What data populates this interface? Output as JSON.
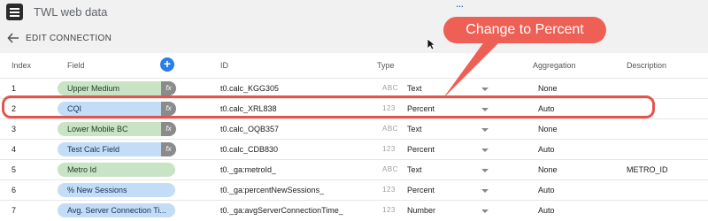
{
  "app": {
    "title": "TWL web data",
    "top_mark": "…"
  },
  "header": {
    "title": "EDIT CONNECTION"
  },
  "table": {
    "columns": {
      "index": "Index",
      "field": "Field",
      "id": "ID",
      "type": "Type",
      "aggregation": "Aggregation",
      "description": "Description"
    },
    "add_button": "+",
    "rows": [
      {
        "index": "1",
        "field": "Upper Medium",
        "chip": "green",
        "fx": "fx",
        "id": "t0.calc_KGG305",
        "type_icon": "ABC",
        "type": "Text",
        "aggregation": "None",
        "description": ""
      },
      {
        "index": "2",
        "field": "CQI",
        "chip": "blue",
        "fx": "fx",
        "id": "t0.calc_XRL838",
        "type_icon": "123",
        "type": "Percent",
        "aggregation": "Auto",
        "description": ""
      },
      {
        "index": "3",
        "field": "Lower Mobile BC",
        "chip": "green",
        "fx": "fx",
        "id": "t0.calc_OQB357",
        "type_icon": "ABC",
        "type": "Text",
        "aggregation": "None",
        "description": ""
      },
      {
        "index": "4",
        "field": "Test Calc Field",
        "chip": "blue",
        "fx": "fx",
        "id": "t0.calc_CDB830",
        "type_icon": "123",
        "type": "Percent",
        "aggregation": "Auto",
        "description": ""
      },
      {
        "index": "5",
        "field": "Metro Id",
        "chip": "green",
        "fx": "",
        "id": "t0._ga:metroId_",
        "type_icon": "ABC",
        "type": "Text",
        "aggregation": "None",
        "description": "METRO_ID"
      },
      {
        "index": "6",
        "field": "% New Sessions",
        "chip": "blue",
        "fx": "",
        "id": "t0._ga:percentNewSessions_",
        "type_icon": "123",
        "type": "Percent",
        "aggregation": "Auto",
        "description": ""
      },
      {
        "index": "7",
        "field": "Avg. Server Connection Ti...",
        "chip": "blue",
        "fx": "",
        "id": "t0._ga:avgServerConnectionTime_",
        "type_icon": "123",
        "type": "Number",
        "aggregation": "Auto",
        "description": ""
      }
    ]
  },
  "annotation": {
    "callout": "Change to Percent"
  },
  "colors": {
    "accent": "#2b7de9",
    "callout": "#ee6055",
    "highlight": "#e4544e",
    "dimension_chip": "#c9e4c5",
    "metric_chip": "#c4ddf7"
  }
}
